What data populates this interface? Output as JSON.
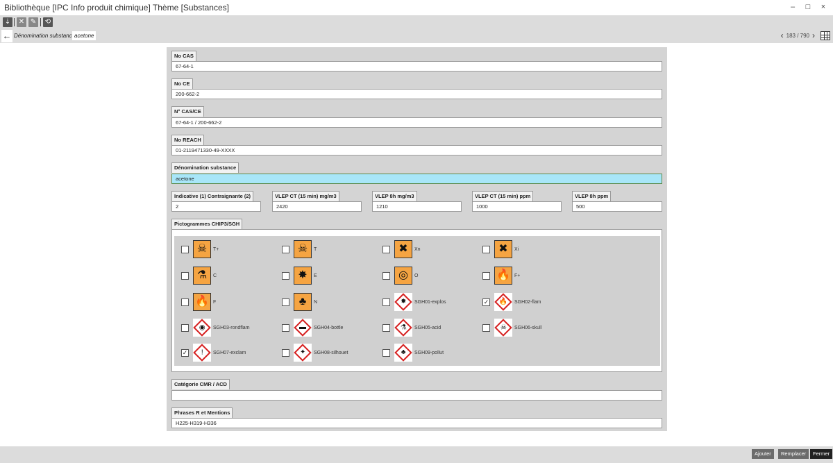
{
  "window": {
    "title": "Bibliothèque [IPC Info produit chimique] Thème [Substances]",
    "controls": [
      "–",
      "□",
      "×"
    ]
  },
  "toolbar": {
    "icons": [
      "pin-icon",
      "delete-icon",
      "edit-icon",
      "refresh-icon"
    ],
    "glyphs": [
      "⇣",
      "✕",
      "✎",
      "⟲"
    ]
  },
  "nav": {
    "back_glyph": "←",
    "crumb_label": "Dénomination substance",
    "crumb_value": "acetone",
    "prev_glyph": "‹",
    "next_glyph": "›",
    "pager_text": "183 / 790"
  },
  "form": {
    "no_cas": {
      "label": "No CAS",
      "value": "67-64-1"
    },
    "no_ce": {
      "label": "No CE",
      "value": "200-662-2"
    },
    "cas_ce": {
      "label": "N° CAS/CE",
      "value": "67-64-1 / 200-662-2"
    },
    "no_reach": {
      "label": "No REACH",
      "value": "01-2119471330-49-XXXX"
    },
    "denomination": {
      "label": "Dénomination substance",
      "value": "acetone"
    },
    "indicative": {
      "label": "Indicative (1) Contraignante (2)",
      "value": "2"
    },
    "vlep_ct_mg": {
      "label": "VLEP CT (15 min) mg/m3",
      "value": "2420"
    },
    "vlep_8h_mg": {
      "label": "VLEP 8h mg/m3",
      "value": "1210"
    },
    "vlep_ct_ppm": {
      "label": "VLEP CT (15 min) ppm",
      "value": "1000"
    },
    "vlep_8h_ppm": {
      "label": "VLEP 8h ppm",
      "value": "500"
    },
    "pictos_label": "Pictogrammes CHIP3/SGH",
    "cmr": {
      "label": "Catégorie CMR / ACD",
      "value": ""
    },
    "phrases": {
      "label": "Phrases R et Mentions",
      "value": "H225-H319-H336"
    }
  },
  "pictograms": [
    {
      "label": "T+",
      "checked": false,
      "style": "orange",
      "glyph": "☠",
      "icon": "skull-icon"
    },
    {
      "label": "T",
      "checked": false,
      "style": "orange",
      "glyph": "☠",
      "icon": "skull-icon"
    },
    {
      "label": "Xn",
      "checked": false,
      "style": "orange",
      "glyph": "✖",
      "icon": "cross-icon"
    },
    {
      "label": "Xi",
      "checked": false,
      "style": "orange",
      "glyph": "✖",
      "icon": "cross-icon"
    },
    {
      "label": "C",
      "checked": false,
      "style": "orange",
      "glyph": "⚗",
      "icon": "corrosive-icon"
    },
    {
      "label": "E",
      "checked": false,
      "style": "orange",
      "glyph": "✸",
      "icon": "explosive-icon"
    },
    {
      "label": "O",
      "checked": false,
      "style": "orange",
      "glyph": "◎",
      "icon": "oxidizer-icon"
    },
    {
      "label": "F+",
      "checked": false,
      "style": "orange",
      "glyph": "🔥",
      "icon": "flame-icon"
    },
    {
      "label": "F",
      "checked": false,
      "style": "orange",
      "glyph": "🔥",
      "icon": "flame-icon"
    },
    {
      "label": "N",
      "checked": false,
      "style": "orange",
      "glyph": "♣",
      "icon": "dead-tree-icon"
    },
    {
      "label": "SGH01-explos",
      "checked": false,
      "style": "diamond",
      "glyph": "✸",
      "icon": "exploding-bomb-icon"
    },
    {
      "label": "SGH02-flam",
      "checked": true,
      "style": "diamond",
      "glyph": "🔥",
      "icon": "flame-icon"
    },
    {
      "label": "SGH03-rondflam",
      "checked": false,
      "style": "diamond",
      "glyph": "◉",
      "icon": "flame-over-circle-icon"
    },
    {
      "label": "SGH04-bottle",
      "checked": false,
      "style": "diamond",
      "glyph": "▬",
      "icon": "gas-cylinder-icon"
    },
    {
      "label": "SGH05-acid",
      "checked": false,
      "style": "diamond",
      "glyph": "⚗",
      "icon": "corrosion-icon"
    },
    {
      "label": "SGH06-skull",
      "checked": false,
      "style": "diamond",
      "glyph": "☠",
      "icon": "skull-icon"
    },
    {
      "label": "SGH07-exclam",
      "checked": true,
      "style": "diamond",
      "glyph": "!",
      "icon": "exclamation-icon"
    },
    {
      "label": "SGH08-silhouet",
      "checked": false,
      "style": "diamond",
      "glyph": "✦",
      "icon": "health-hazard-icon"
    },
    {
      "label": "SGH09-pollut",
      "checked": false,
      "style": "diamond",
      "glyph": "♣",
      "icon": "environment-icon"
    }
  ],
  "footer": {
    "ajouter": "Ajouter",
    "remplacer": "Remplacer",
    "fermer": "Fermer"
  }
}
